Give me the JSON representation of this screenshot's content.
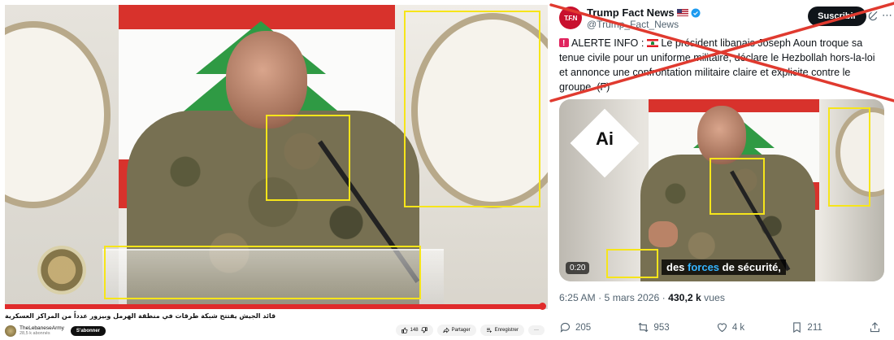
{
  "youtube": {
    "title": "قائد الجيش يفتتح شبكة طرقات في منطقة الهرمل وبيزور عدداً من المراكز العسكرية",
    "channel_name": "TheLebaneseArmy",
    "subscribers": "28,5 k abonnés",
    "subscribe_label": "S'abonner",
    "likes": "148",
    "share_label": "Partager",
    "save_label": "Enregistrer",
    "more_label": "···",
    "progress_fraction": 0.99,
    "accent": "#e02b2b"
  },
  "tweet": {
    "author_name": "Trump Fact News",
    "handle": "@Trump_Fact_News",
    "avatar_text": "T.F.N",
    "follow_label": "Suscribir",
    "alert_prefix": "ALERTE INFO :",
    "body": "Le président libanais Joseph Aoun troque sa tenue civile pour un uniforme militaire, déclare le Hezbollah hors-la-loi et annonce une confrontation militaire claire et explicite contre le groupe. (F)",
    "media": {
      "ai_label": "Ai",
      "subtitle_pre": "des ",
      "subtitle_hl": "forces",
      "subtitle_post": " de sécurité,",
      "video_time": "0:20"
    },
    "time": "6:25 AM · 5 mars 2026 · ",
    "views_count": "430,2 k",
    "views_label": " vues",
    "replies": "205",
    "reposts": "953",
    "likes": "4 k",
    "bookmarks": "211",
    "colors": {
      "cross": "#e03a2f",
      "highlight_box": "#f6e51a",
      "verified": "#1d9bf0"
    }
  }
}
